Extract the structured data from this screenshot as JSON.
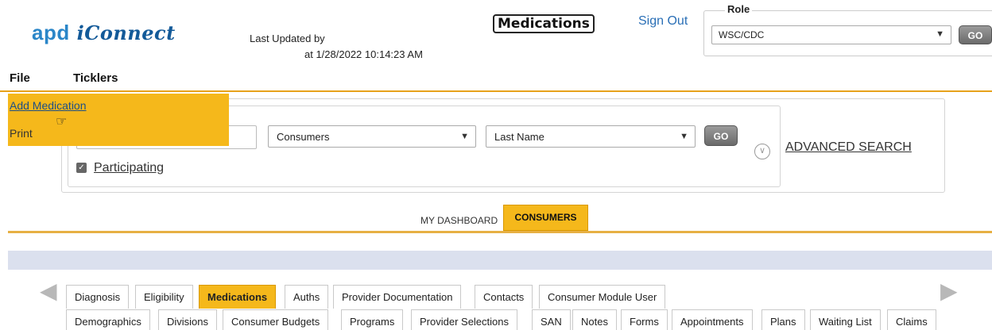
{
  "app": {
    "logo_prefix": "apd",
    "logo_name": "iConnect",
    "last_updated_label": "Last Updated by",
    "last_updated_at": "at 1/28/2022 10:14:23 AM",
    "page_title": "Medications",
    "sign_out": "Sign Out"
  },
  "role": {
    "legend": "Role",
    "selected": "WSC/CDC",
    "go": "GO"
  },
  "menu": {
    "file": "File",
    "ticklers": "Ticklers"
  },
  "file_dropdown": {
    "items": [
      "Add Medication",
      "Print"
    ]
  },
  "search": {
    "input_value": "",
    "type_selected": "Consumers",
    "field_selected": "Last Name",
    "go": "GO",
    "advanced": "ADVANCED SEARCH",
    "participating_label": "Participating",
    "participating_checked": true
  },
  "dashboard": {
    "my_dashboard": "MY DASHBOARD",
    "consumers": "CONSUMERS"
  },
  "tabs_row1": [
    "Diagnosis",
    "Eligibility",
    "Medications",
    "Auths",
    "Provider Documentation",
    "Contacts",
    "Consumer Module User"
  ],
  "tabs_row2": [
    "Demographics",
    "Divisions",
    "Consumer Budgets",
    "Programs",
    "Provider Selections",
    "SAN",
    "Notes",
    "Forms",
    "Appointments",
    "Plans",
    "Waiting List",
    "Claims"
  ],
  "active_tab": "Medications",
  "colors": {
    "accent": "#f5b81b",
    "link": "#2a6fb6",
    "band": "#dbe0ee"
  },
  "icons": [
    "cursor-hand-icon",
    "chevron-down-icon",
    "expand-circle-icon",
    "arrow-left-icon",
    "arrow-right-icon",
    "checkbox-checked-icon"
  ]
}
